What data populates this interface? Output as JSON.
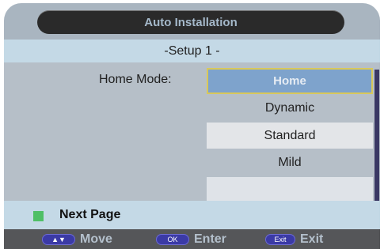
{
  "header": {
    "title": "Auto Installation"
  },
  "subtitle": "-Setup 1 -",
  "setting": {
    "label": "Home Mode:",
    "options": [
      "Home",
      "Dynamic",
      "Standard",
      "Mild",
      ""
    ],
    "selected": "Home"
  },
  "next_page": {
    "label": "Next Page",
    "key_color": "#4fbf66"
  },
  "hints": {
    "move": {
      "key": "▲▼",
      "label": "Move"
    },
    "ok": {
      "key": "OK",
      "label": "Enter"
    },
    "exit": {
      "key": "Exit",
      "label": "Exit"
    }
  },
  "colors": {
    "frame": "#a9b5c0",
    "title_bar": "#2a2a2a",
    "subtitle_bar": "#c4d9e6",
    "selected_option": "#7ea3cc",
    "selected_border": "#d9c85a",
    "key_pill": "#3b3aa6",
    "hint_bar": "#555659"
  }
}
